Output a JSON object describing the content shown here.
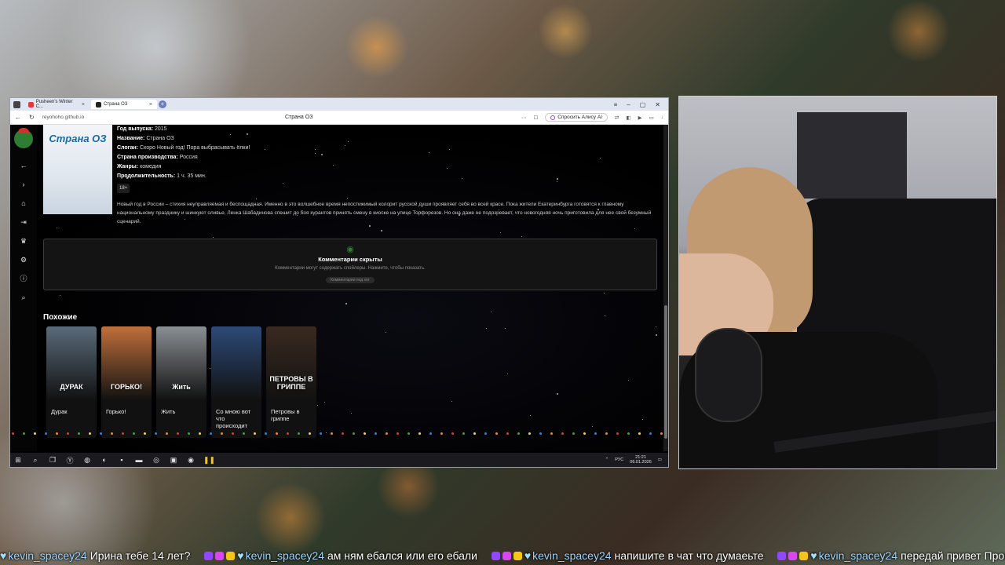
{
  "browser": {
    "tabs": [
      {
        "label": "Pusheen's Winter C..."
      },
      {
        "label": "Страна ОЗ"
      }
    ],
    "url": "reyohoho.github.io",
    "page_title": "Страна ОЗ",
    "alice_label": "Спросить Алису AI"
  },
  "movie": {
    "poster_text": "Страна ОЗ",
    "fields": [
      {
        "label": "Год выпуска:",
        "value": "2015"
      },
      {
        "label": "Название:",
        "value": "Страна ОЗ"
      },
      {
        "label": "Слоган:",
        "value": "Скоро Новый год! Пора выбрасывать ёлки!"
      },
      {
        "label": "Страна производства:",
        "value": "Россия"
      },
      {
        "label": "Жанры:",
        "value": "комедия"
      },
      {
        "label": "Продолжительность:",
        "value": "1 ч. 35 мин."
      }
    ],
    "age": "18+",
    "description": "Новый год в России – стихия неуправляемая и беспощадная. Именно в это волшебное время непостижимый колорит русской души проявляет себя во всей красе. Пока жители Екатеринбурга готовятся к главному национальному празднику и шинкуют оливье, Ленка Шабадинова спешит до боя курантов принять смену в киоске на улице Торфорезов. Но она даже не подозревает, что новогодняя ночь приготовила для нее свой безумный сценарий."
  },
  "comments": {
    "title": "Комментарии скрыты",
    "subtitle": "Комментарии могут содержать спойлеры. Нажмите, чтобы показать.",
    "button": "Комментарии под хот"
  },
  "similar": {
    "title": "Похожие",
    "items": [
      {
        "label": "Дурак",
        "poster_text": "ДУРАК",
        "color": "#5a6b7a"
      },
      {
        "label": "Горько!",
        "poster_text": "ГОРЬКО!",
        "color": "#c0703a"
      },
      {
        "label": "Жить",
        "poster_text": "Жить",
        "color": "#8a8f94"
      },
      {
        "label": "Со мною вот что происходит",
        "poster_text": "",
        "color": "#2d4a78"
      },
      {
        "label": "Петровы в гриппе",
        "poster_text": "ПЕТРОВЫ В ГРИППЕ",
        "color": "#3a2a20"
      }
    ]
  },
  "taskbar": {
    "lang": "РУС",
    "time": "21:21",
    "date": "06.01.2026"
  },
  "chat": [
    {
      "user": "kevin_spacey24",
      "text": "Ирина тебе 14 лет?"
    },
    {
      "user": "kevin_spacey24",
      "text": "ам ням ебался или его ебали"
    },
    {
      "user": "kevin_spacey24",
      "text": "напишите в чат что думаеьте"
    },
    {
      "user": "kevin_spacey24",
      "text": "передай привет Прокиту"
    }
  ]
}
